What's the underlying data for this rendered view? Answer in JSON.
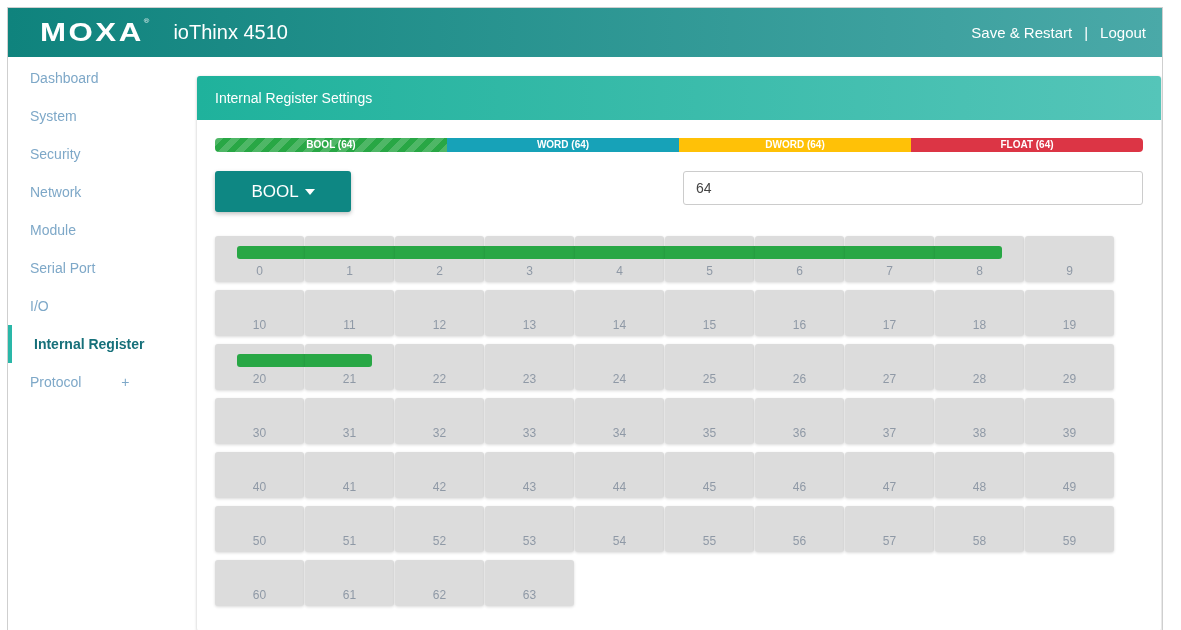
{
  "header": {
    "logo": "MOXA",
    "logo_mark": "®",
    "product": "ioThinx 4510",
    "links": [
      {
        "label": "Save & Restart"
      },
      {
        "label": "Logout"
      }
    ],
    "separator": "|"
  },
  "sidebar": {
    "items": [
      {
        "label": "Dashboard",
        "selected": false
      },
      {
        "label": "System",
        "selected": false
      },
      {
        "label": "Security",
        "selected": false
      },
      {
        "label": "Network",
        "selected": false
      },
      {
        "label": "Module",
        "selected": false
      },
      {
        "label": "Serial Port",
        "selected": false
      },
      {
        "label": "I/O",
        "selected": false
      },
      {
        "label": "Internal Register",
        "selected": true
      },
      {
        "label": "Protocol",
        "selected": false,
        "expander": "+"
      }
    ]
  },
  "panel": {
    "title": "Internal Register Settings",
    "types": [
      {
        "label": "BOOL (64)",
        "color": "#28a745",
        "selected": true
      },
      {
        "label": "WORD (64)",
        "color": "#17a2b8",
        "selected": false
      },
      {
        "label": "DWORD (64)",
        "color": "#ffc107",
        "selected": false
      },
      {
        "label": "FLOAT (64)",
        "color": "#dc3545",
        "selected": false
      }
    ],
    "type_dropdown": {
      "value": "BOOL"
    },
    "count_field": {
      "value": "64"
    },
    "cells": [
      {
        "label": "0",
        "allocated": true
      },
      {
        "label": "1",
        "allocated": true
      },
      {
        "label": "2",
        "allocated": true
      },
      {
        "label": "3",
        "allocated": true
      },
      {
        "label": "4",
        "allocated": true
      },
      {
        "label": "5",
        "allocated": true
      },
      {
        "label": "6",
        "allocated": true
      },
      {
        "label": "7",
        "allocated": true
      },
      {
        "label": "8",
        "allocated": true
      },
      {
        "label": "9",
        "allocated": false
      },
      {
        "label": "10",
        "allocated": false
      },
      {
        "label": "11",
        "allocated": false
      },
      {
        "label": "12",
        "allocated": false
      },
      {
        "label": "13",
        "allocated": false
      },
      {
        "label": "14",
        "allocated": false
      },
      {
        "label": "15",
        "allocated": false
      },
      {
        "label": "16",
        "allocated": false
      },
      {
        "label": "17",
        "allocated": false
      },
      {
        "label": "18",
        "allocated": false
      },
      {
        "label": "19",
        "allocated": false
      },
      {
        "label": "20",
        "allocated": true
      },
      {
        "label": "21",
        "allocated": true
      },
      {
        "label": "22",
        "allocated": false
      },
      {
        "label": "23",
        "allocated": false
      },
      {
        "label": "24",
        "allocated": false
      },
      {
        "label": "25",
        "allocated": false
      },
      {
        "label": "26",
        "allocated": false
      },
      {
        "label": "27",
        "allocated": false
      },
      {
        "label": "28",
        "allocated": false
      },
      {
        "label": "29",
        "allocated": false
      },
      {
        "label": "30",
        "allocated": false
      },
      {
        "label": "31",
        "allocated": false
      },
      {
        "label": "32",
        "allocated": false
      },
      {
        "label": "33",
        "allocated": false
      },
      {
        "label": "34",
        "allocated": false
      },
      {
        "label": "35",
        "allocated": false
      },
      {
        "label": "36",
        "allocated": false
      },
      {
        "label": "37",
        "allocated": false
      },
      {
        "label": "38",
        "allocated": false
      },
      {
        "label": "39",
        "allocated": false
      },
      {
        "label": "40",
        "allocated": false
      },
      {
        "label": "41",
        "allocated": false
      },
      {
        "label": "42",
        "allocated": false
      },
      {
        "label": "43",
        "allocated": false
      },
      {
        "label": "44",
        "allocated": false
      },
      {
        "label": "45",
        "allocated": false
      },
      {
        "label": "46",
        "allocated": false
      },
      {
        "label": "47",
        "allocated": false
      },
      {
        "label": "48",
        "allocated": false
      },
      {
        "label": "49",
        "allocated": false
      },
      {
        "label": "50",
        "allocated": false
      },
      {
        "label": "51",
        "allocated": false
      },
      {
        "label": "52",
        "allocated": false
      },
      {
        "label": "53",
        "allocated": false
      },
      {
        "label": "54",
        "allocated": false
      },
      {
        "label": "55",
        "allocated": false
      },
      {
        "label": "56",
        "allocated": false
      },
      {
        "label": "57",
        "allocated": false
      },
      {
        "label": "58",
        "allocated": false
      },
      {
        "label": "59",
        "allocated": false
      },
      {
        "label": "60",
        "allocated": false
      },
      {
        "label": "61",
        "allocated": false
      },
      {
        "label": "62",
        "allocated": false
      },
      {
        "label": "63",
        "allocated": false
      }
    ]
  }
}
